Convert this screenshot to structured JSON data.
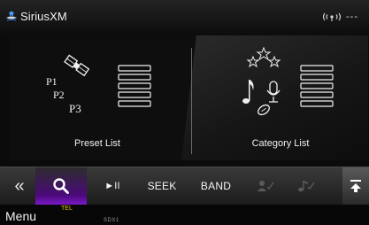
{
  "header": {
    "brand": "SiriusXM",
    "signal_text": "---"
  },
  "presets": {
    "label": "Preset List",
    "tags": [
      "P1",
      "P2",
      "P3"
    ]
  },
  "categories": {
    "label": "Category List"
  },
  "toolbar": {
    "play_pause": "►II",
    "seek": "SEEK",
    "band": "BAND"
  },
  "footer": {
    "menu": "Menu",
    "tel": "TEL",
    "small_text": "SDX1"
  },
  "colors": {
    "active_accent": "#7a18c9",
    "tel": "#e6c600"
  }
}
